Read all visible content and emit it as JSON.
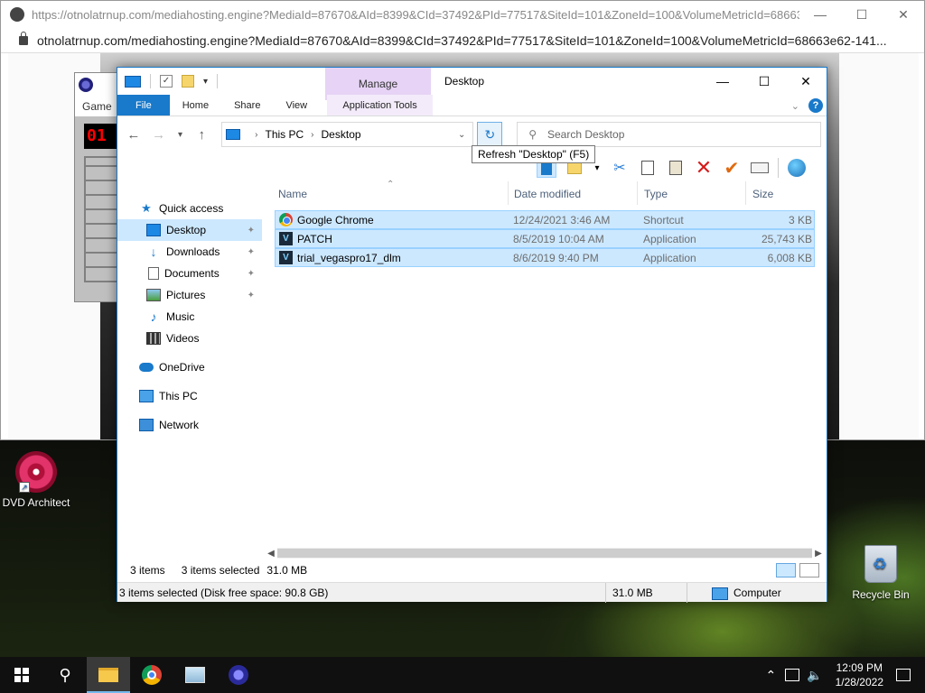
{
  "browser": {
    "title_url": "https://otnolatrnup.com/mediahosting.engine?MediaId=87670&AId=8399&CId=37492&PId=77517&SiteId=101&ZoneId=100&VolumeMetricId=68663e62-1...",
    "address_url": "otnolatrnup.com/mediahosting.engine?MediaId=87670&AId=8399&CId=37492&PId=77517&SiteId=101&ZoneId=100&VolumeMetricId=68663e62-141..."
  },
  "minesweeper": {
    "menu_label": "Game",
    "counter": "01"
  },
  "explorer": {
    "manage_label": "Manage",
    "window_title": "Desktop",
    "tabs": [
      "File",
      "Home",
      "Share",
      "View",
      "Application Tools"
    ],
    "breadcrumb": [
      "This PC",
      "Desktop"
    ],
    "search_placeholder": "Search Desktop",
    "tooltip": "Refresh \"Desktop\" (F5)",
    "nav_pane": [
      {
        "label": "Quick access",
        "icon": "star-icon"
      },
      {
        "label": "Desktop",
        "icon": "desktop-icon",
        "pinned": true,
        "selected": true
      },
      {
        "label": "Downloads",
        "icon": "download-icon",
        "pinned": true
      },
      {
        "label": "Documents",
        "icon": "documents-icon",
        "pinned": true
      },
      {
        "label": "Pictures",
        "icon": "pictures-icon",
        "pinned": true
      },
      {
        "label": "Music",
        "icon": "music-icon"
      },
      {
        "label": "Videos",
        "icon": "videos-icon"
      },
      {
        "label": "OneDrive",
        "icon": "onedrive-icon"
      },
      {
        "label": "This PC",
        "icon": "this-pc-icon"
      },
      {
        "label": "Network",
        "icon": "network-icon"
      }
    ],
    "columns": [
      "Name",
      "Date modified",
      "Type",
      "Size"
    ],
    "files": [
      {
        "name": "Google Chrome",
        "date": "12/24/2021 3:46 AM",
        "type": "Shortcut",
        "size": "3 KB",
        "icon": "chrome-icon"
      },
      {
        "name": "PATCH",
        "date": "8/5/2019 10:04 AM",
        "type": "Application",
        "size": "25,743 KB",
        "icon": "vegas-app-icon"
      },
      {
        "name": "trial_vegaspro17_dlm",
        "date": "8/6/2019 9:40 PM",
        "type": "Application",
        "size": "6,008 KB",
        "icon": "vegas-app-icon"
      }
    ],
    "status": {
      "items": "3 items",
      "selected": "3 items selected",
      "selected_size": "31.0 MB"
    },
    "details_bar": {
      "info": "3 items selected (Disk free space: 90.8 GB)",
      "size": "31.0 MB",
      "location": "Computer"
    }
  },
  "desktop": {
    "icons": [
      {
        "label": "DVD Architect"
      },
      {
        "label": "Recycle Bin"
      }
    ]
  },
  "taskbar": {
    "time": "12:09 PM",
    "date": "1/28/2022"
  }
}
